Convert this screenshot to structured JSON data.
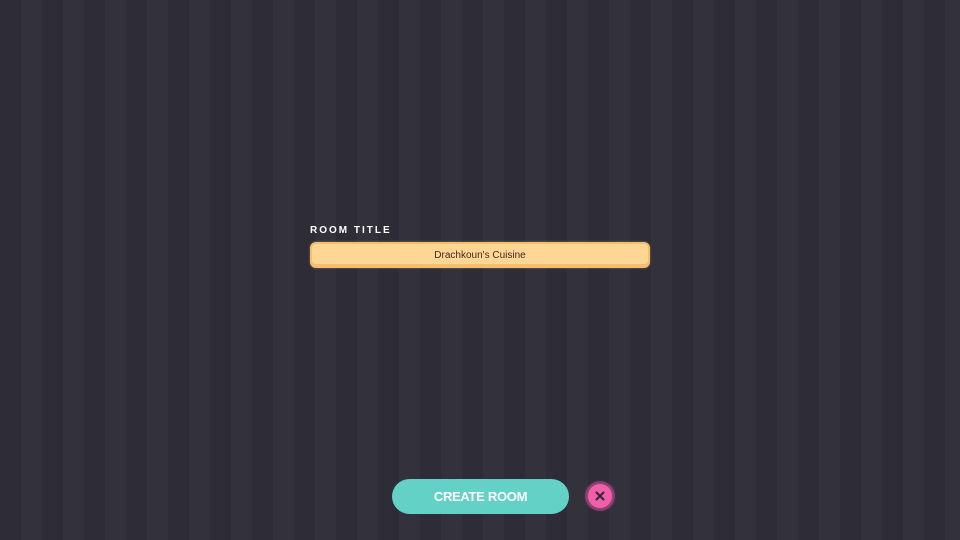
{
  "room_form": {
    "title_label": "ROOM TITLE",
    "title_value": "Drachkoun's Cuisine"
  },
  "actions": {
    "create_label": "CREATE ROOM",
    "close_icon": "close-icon"
  },
  "colors": {
    "background": "#2d2b36",
    "input_fill": "#ffd694",
    "create_button": "#63d1c6",
    "close_button": "#f15faa"
  }
}
